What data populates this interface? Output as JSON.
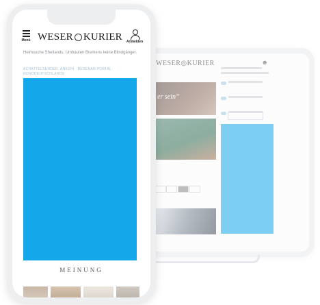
{
  "tablet": {
    "logo": "WESER◎KURIER",
    "hero_text": "er sein“"
  },
  "phone": {
    "header": {
      "menu_label": "Menü",
      "brand_left": "WESER",
      "brand_right": "KURIER",
      "login_label": "Anmelden"
    },
    "teaser_text": "Heimsuche Shetlands, Umbauten Bremens keine Blindgänger.",
    "tags_text": "ACHATTELSENDER, ANKEIN · BEDENAN PORTAL NORDDEUTSCHLANDS",
    "section_label": "MEINUNG"
  },
  "colors": {
    "ad_blue": "#14a7ea",
    "frame": "#eceef0"
  }
}
